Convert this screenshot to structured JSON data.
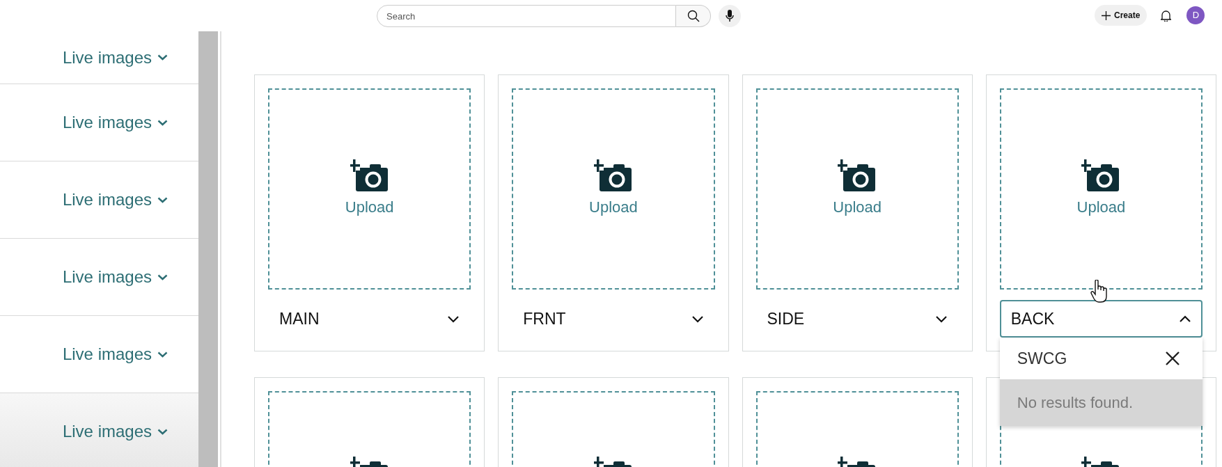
{
  "topbar": {
    "search": {
      "placeholder": "Search"
    },
    "create_button": "Create",
    "avatar": "D"
  },
  "sidebar": {
    "items": [
      {
        "label": "Live images"
      },
      {
        "label": "Live images"
      },
      {
        "label": "Live images"
      },
      {
        "label": "Live images"
      },
      {
        "label": "Live images"
      },
      {
        "label": "Live images"
      }
    ]
  },
  "image_slots": [
    {
      "kind": "full",
      "upload_label": "Upload",
      "variant": "MAIN",
      "open": false
    },
    {
      "kind": "full",
      "upload_label": "Upload",
      "variant": "FRNT",
      "open": false
    },
    {
      "kind": "full",
      "upload_label": "Upload",
      "variant": "SIDE",
      "open": false
    },
    {
      "kind": "full",
      "upload_label": "Upload",
      "variant": "BACK",
      "open": true,
      "dropdown": {
        "query": "SWCG",
        "message": "No results found."
      }
    },
    {
      "kind": "cut_off"
    },
    {
      "kind": "cut_off"
    },
    {
      "kind": "cut_off"
    },
    {
      "kind": "cut_off"
    }
  ]
}
